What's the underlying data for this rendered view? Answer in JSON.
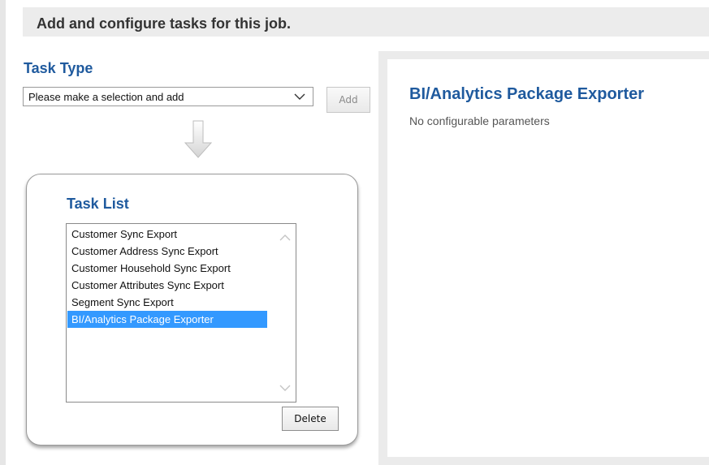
{
  "header": {
    "title": "Add and configure tasks for this job."
  },
  "task_type": {
    "label": "Task Type",
    "select_value": "Please make a selection and add",
    "add_label": "Add"
  },
  "task_list": {
    "title": "Task List",
    "items": [
      {
        "label": "Customer Sync Export",
        "selected": false
      },
      {
        "label": "Customer Address Sync Export",
        "selected": false
      },
      {
        "label": "Customer Household Sync Export",
        "selected": false
      },
      {
        "label": "Customer Attributes Sync Export",
        "selected": false
      },
      {
        "label": "Segment Sync Export",
        "selected": false
      },
      {
        "label": "BI/Analytics Package Exporter",
        "selected": true
      }
    ],
    "delete_label": "Delete"
  },
  "detail": {
    "title": "BI/Analytics Package Exporter",
    "text": "No configurable parameters"
  },
  "colors": {
    "accent_blue": "#1f5a9e",
    "selection_blue": "#3399ff",
    "header_bg": "#ececec"
  },
  "icons": {
    "select_chevron": "chevron-down-icon",
    "flow_arrow": "arrow-down-icon",
    "scroll_up": "chevron-up-icon",
    "scroll_down": "chevron-down-icon"
  }
}
